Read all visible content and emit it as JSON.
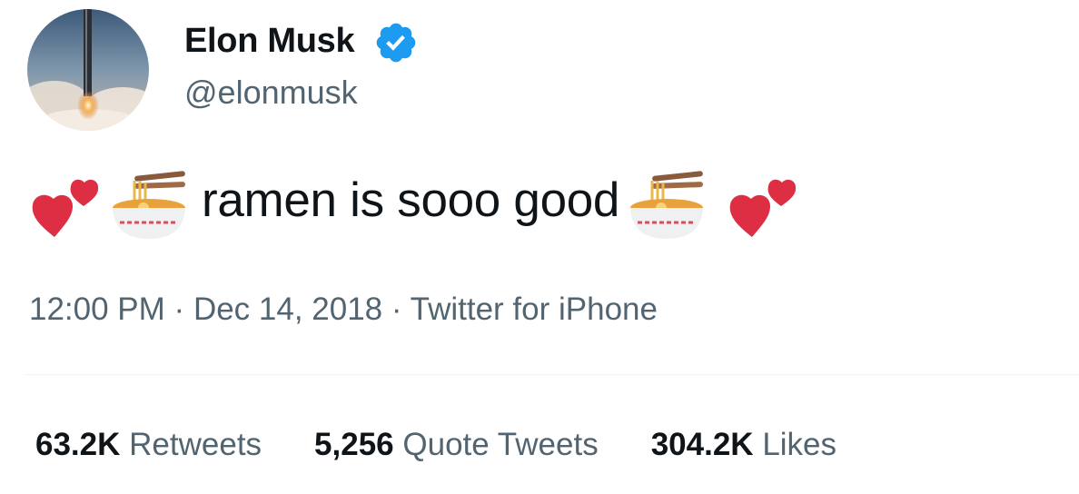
{
  "author": {
    "name": "Elon Musk",
    "handle": "@elonmusk",
    "verified": true
  },
  "tweet": {
    "text": "ramen is sooo good",
    "emoji_before": [
      "two-hearts-icon",
      "ramen-bowl-icon"
    ],
    "emoji_after": [
      "ramen-bowl-icon",
      "two-hearts-icon"
    ]
  },
  "meta": {
    "time": "12:00 PM",
    "separator": "·",
    "date": "Dec 14, 2018",
    "source": "Twitter for iPhone"
  },
  "stats": {
    "retweets_count": "63.2K",
    "retweets_label": "Retweets",
    "quotes_count": "5,256",
    "quotes_label": "Quote Tweets",
    "likes_count": "304.2K",
    "likes_label": "Likes"
  },
  "colors": {
    "text": "#0f1419",
    "secondary": "#536471",
    "verified_blue": "#1d9bf0",
    "heart_red": "#dd2e44"
  }
}
